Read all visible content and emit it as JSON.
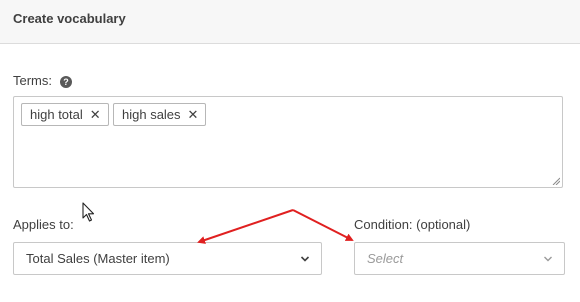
{
  "header": {
    "title": "Create vocabulary"
  },
  "terms": {
    "label": "Terms:",
    "help_icon": "?",
    "chips": [
      {
        "label": "high total",
        "remove": "✕"
      },
      {
        "label": "high sales",
        "remove": "✕"
      }
    ]
  },
  "applies_to": {
    "label": "Applies to:",
    "value": "Total Sales (Master item)"
  },
  "condition": {
    "label": "Condition: (optional)",
    "placeholder": "Select"
  },
  "annotation": {
    "arrow_color": "#e02020",
    "arrow_count": 2
  }
}
